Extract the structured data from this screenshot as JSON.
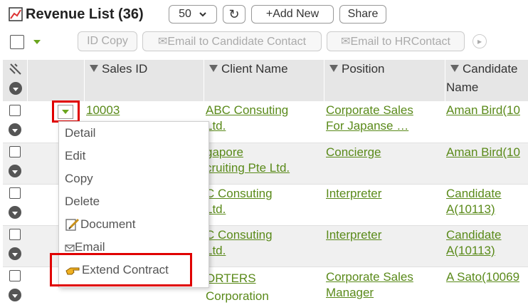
{
  "toolbar": {
    "title": "Revenue List (36)",
    "per_page": "50",
    "refresh_symbol": "↻",
    "add_new_label": "+Add New",
    "share_label": "Share",
    "id_copy_label": "ID Copy",
    "email_candidate_label": "✉Email to Candidate Contact",
    "email_hr_label": "✉Email to HRContact",
    "next_symbol": "▸"
  },
  "table": {
    "headers": [
      "Sales ID",
      "Client Name",
      "Position",
      "Candidate",
      "Name"
    ],
    "rows": [
      {
        "sales_id": "10003",
        "client_1": "ABC Consuting",
        "client_2": "Ltd.",
        "position_1": "Corporate Sales",
        "position_2": "For Japanse …",
        "candidate_1": "Aman Bird(10",
        "candidate_2": ""
      },
      {
        "sales_id": "",
        "client_1": "gapore",
        "client_2": "cruiting Pte Ltd.",
        "position_1": "Concierge",
        "position_2": "",
        "candidate_1": "Aman Bird(10",
        "candidate_2": ""
      },
      {
        "sales_id": "",
        "client_1": "C Consuting",
        "client_2": "Ltd.",
        "position_1": "Interpreter",
        "position_2": "",
        "candidate_1": "Candidate",
        "candidate_2": "A(10113)"
      },
      {
        "sales_id": "",
        "client_1": "C Consuting",
        "client_2": "Ltd.",
        "position_1": "Interpreter",
        "position_2": "",
        "candidate_1": "Candidate",
        "candidate_2": "A(10113)"
      },
      {
        "sales_id": "",
        "client_1": "ORTERS",
        "client_2": "Corporation",
        "position_1": "Corporate Sales",
        "position_2": "Manager",
        "candidate_1": "A Sato(10069",
        "candidate_2": ""
      }
    ]
  },
  "menu": {
    "items": [
      "Detail",
      "Edit",
      "Copy",
      "Delete",
      "Document",
      "Email",
      "Extend Contract"
    ]
  },
  "colors": {
    "link": "#5a8a1a",
    "highlight": "#e00000",
    "header_bg": "#e6e6e6"
  }
}
